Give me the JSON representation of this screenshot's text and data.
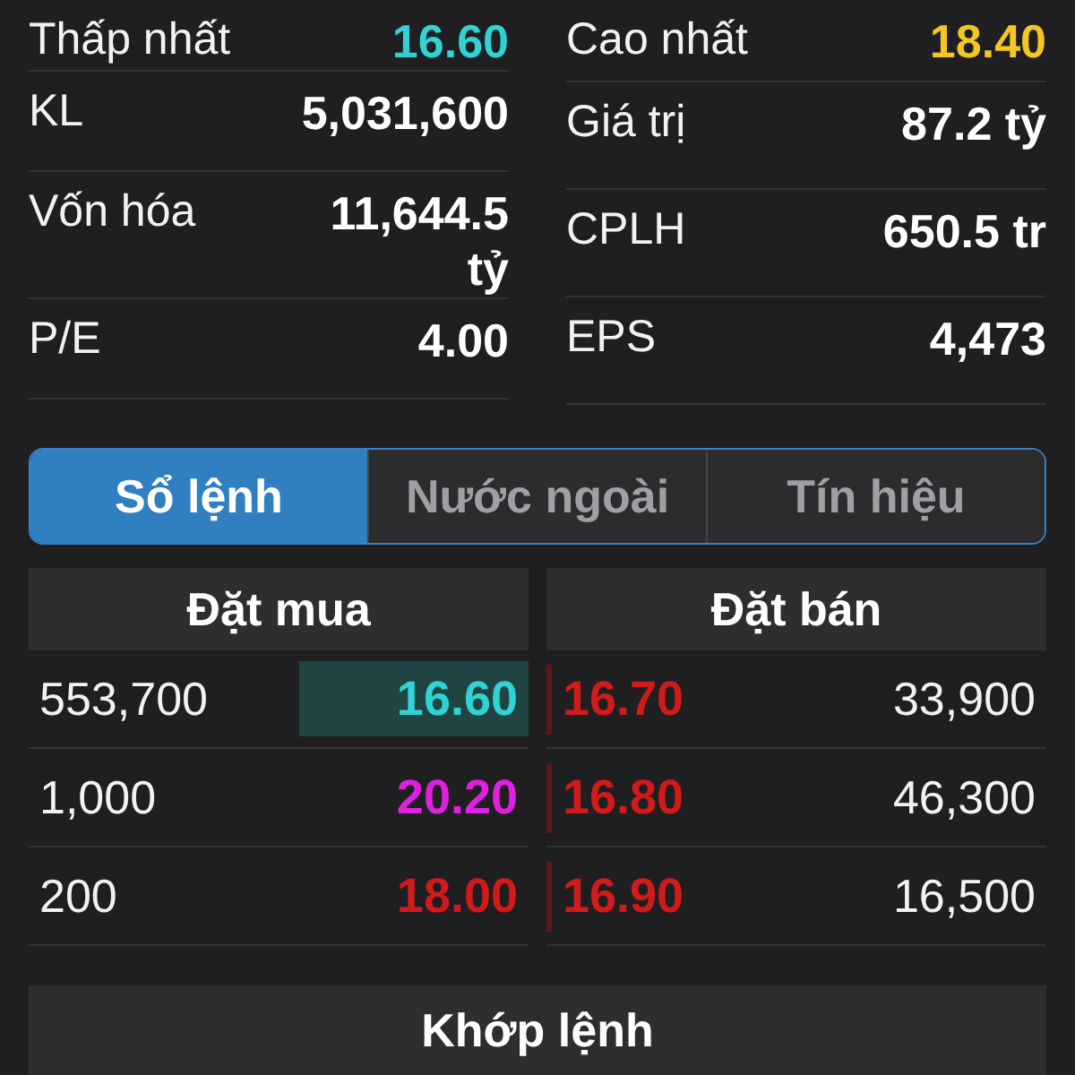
{
  "stats_left": [
    {
      "label": "Thấp nhất",
      "value": "16.60",
      "color": "#2fd3d3"
    },
    {
      "label": "KL",
      "value": "5,031,600",
      "color": "#ffffff"
    },
    {
      "label": "Vốn hóa",
      "value": "11,644.5 tỷ",
      "color": "#ffffff"
    },
    {
      "label": "P/E",
      "value": "4.00",
      "color": "#ffffff"
    }
  ],
  "stats_right": [
    {
      "label": "Cao nhất",
      "value": "18.40",
      "color": "#f3c623"
    },
    {
      "label": "Giá trị",
      "value": "87.2 tỷ",
      "color": "#ffffff"
    },
    {
      "label": "CPLH",
      "value": "650.5 tr",
      "color": "#ffffff"
    },
    {
      "label": "EPS",
      "value": "4,473",
      "color": "#ffffff"
    }
  ],
  "tabs": [
    {
      "label": "Sổ lệnh",
      "selected": true
    },
    {
      "label": "Nước ngoài",
      "selected": false
    },
    {
      "label": "Tín hiệu",
      "selected": false
    }
  ],
  "order_book": {
    "bid_header": "Đặt mua",
    "ask_header": "Đặt bán",
    "rows": [
      {
        "bid": {
          "volume": "553,700",
          "price": "16.60",
          "color": "#2fd3d3",
          "highlighted": true
        },
        "ask": {
          "price": "16.70",
          "color": "#d11a1a",
          "volume": "33,900"
        }
      },
      {
        "bid": {
          "volume": "1,000",
          "price": "20.20",
          "color": "#e020e0",
          "highlighted": false
        },
        "ask": {
          "price": "16.80",
          "color": "#d11a1a",
          "volume": "46,300"
        }
      },
      {
        "bid": {
          "volume": "200",
          "price": "18.00",
          "color": "#d11a1a",
          "highlighted": false
        },
        "ask": {
          "price": "16.90",
          "color": "#d11a1a",
          "volume": "16,500"
        }
      }
    ]
  },
  "matched_header": "Khớp lệnh"
}
